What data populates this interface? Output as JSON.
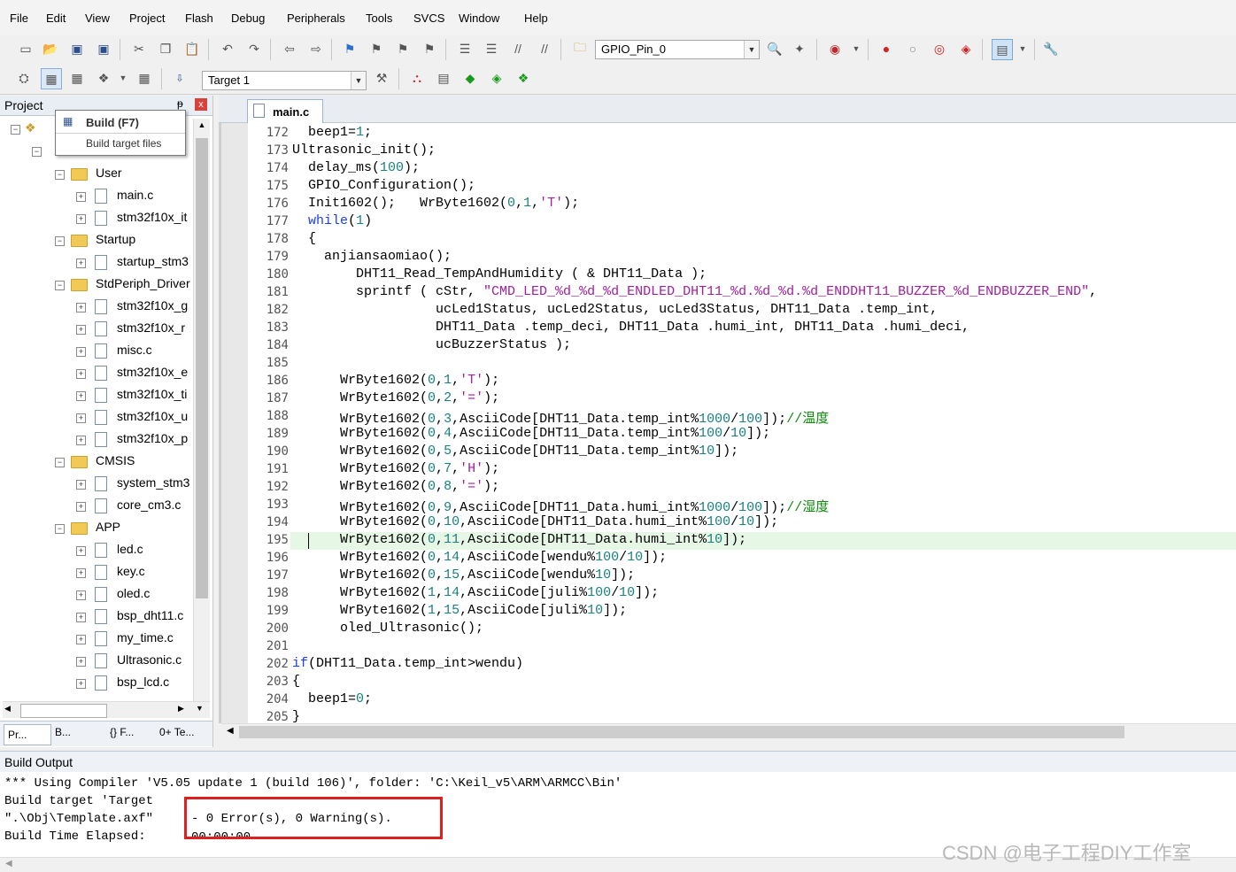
{
  "menu": [
    "File",
    "Edit",
    "View",
    "Project",
    "Flash",
    "Debug",
    "Peripherals",
    "Tools",
    "SVCS",
    "Window",
    "Help"
  ],
  "toolbar1": {
    "target_combo": "GPIO_Pin_0"
  },
  "toolbar2": {
    "target_combo": "Target 1"
  },
  "project_panel": {
    "title": "Project",
    "pin": "ᵽ",
    "close": "x",
    "tooltip": {
      "title": "Build (F7)",
      "desc": "Build target files"
    },
    "tree": [
      {
        "label": "User",
        "type": "folder",
        "indent": 1
      },
      {
        "label": "main.c",
        "type": "file",
        "indent": 2
      },
      {
        "label": "stm32f10x_it",
        "type": "file",
        "indent": 2
      },
      {
        "label": "Startup",
        "type": "folder",
        "indent": 1
      },
      {
        "label": "startup_stm3",
        "type": "file",
        "indent": 2
      },
      {
        "label": "StdPeriph_Driver",
        "type": "folder",
        "indent": 1
      },
      {
        "label": "stm32f10x_g",
        "type": "file",
        "indent": 2
      },
      {
        "label": "stm32f10x_r",
        "type": "file",
        "indent": 2
      },
      {
        "label": "misc.c",
        "type": "file",
        "indent": 2
      },
      {
        "label": "stm32f10x_e",
        "type": "file",
        "indent": 2
      },
      {
        "label": "stm32f10x_ti",
        "type": "file",
        "indent": 2
      },
      {
        "label": "stm32f10x_u",
        "type": "file",
        "indent": 2
      },
      {
        "label": "stm32f10x_p",
        "type": "file",
        "indent": 2
      },
      {
        "label": "CMSIS",
        "type": "folder",
        "indent": 1
      },
      {
        "label": "system_stm3",
        "type": "file",
        "indent": 2
      },
      {
        "label": "core_cm3.c",
        "type": "file",
        "indent": 2
      },
      {
        "label": "APP",
        "type": "folder",
        "indent": 1
      },
      {
        "label": "led.c",
        "type": "file",
        "indent": 2
      },
      {
        "label": "key.c",
        "type": "file",
        "indent": 2
      },
      {
        "label": "oled.c",
        "type": "file",
        "indent": 2
      },
      {
        "label": "bsp_dht11.c",
        "type": "file",
        "indent": 2
      },
      {
        "label": "my_time.c",
        "type": "file",
        "indent": 2
      },
      {
        "label": "Ultrasonic.c",
        "type": "file",
        "indent": 2
      },
      {
        "label": "bsp_lcd.c",
        "type": "file",
        "indent": 2
      }
    ],
    "bottom_tabs": [
      "Pr...",
      "B...",
      "{} F...",
      "0+ Te..."
    ]
  },
  "editor": {
    "tab": "main.c",
    "current_line": 195,
    "lines": [
      {
        "n": 172,
        "html": "  beep1=<span class=\"num\">1</span>;"
      },
      {
        "n": 173,
        "html": "Ultrasonic_init();"
      },
      {
        "n": 174,
        "html": "  delay_ms(<span class=\"num\">100</span>);"
      },
      {
        "n": 175,
        "html": "  GPIO_Configuration();"
      },
      {
        "n": 176,
        "html": "  Init1602();   WrByte1602(<span class=\"num\">0</span>,<span class=\"num\">1</span>,<span class=\"str\">'T'</span>);"
      },
      {
        "n": 177,
        "html": "  <span class=\"kw\">while</span>(<span class=\"num\">1</span>)"
      },
      {
        "n": 178,
        "html": "  {"
      },
      {
        "n": 179,
        "html": "    anjiansaomiao();"
      },
      {
        "n": 180,
        "html": "        DHT11_Read_TempAndHumidity ( & DHT11_Data );"
      },
      {
        "n": 181,
        "html": "        sprintf ( cStr, <span class=\"str\">\"CMD_LED_%d_%d_%d_ENDLED_DHT11_%d.%d_%d.%d_ENDDHT11_BUZZER_%d_ENDBUZZER_END\"</span>,"
      },
      {
        "n": 182,
        "html": "                  ucLed1Status, ucLed2Status, ucLed3Status, DHT11_Data .temp_int,"
      },
      {
        "n": 183,
        "html": "                  DHT11_Data .temp_deci, DHT11_Data .humi_int, DHT11_Data .humi_deci,"
      },
      {
        "n": 184,
        "html": "                  ucBuzzerStatus );"
      },
      {
        "n": 185,
        "html": ""
      },
      {
        "n": 186,
        "html": "      WrByte1602(<span class=\"num\">0</span>,<span class=\"num\">1</span>,<span class=\"str\">'T'</span>);"
      },
      {
        "n": 187,
        "html": "      WrByte1602(<span class=\"num\">0</span>,<span class=\"num\">2</span>,<span class=\"str\">'='</span>);"
      },
      {
        "n": 188,
        "html": "      WrByte1602(<span class=\"num\">0</span>,<span class=\"num\">3</span>,AsciiCode[DHT11_Data.temp_int%<span class=\"num\">1000</span>/<span class=\"num\">100</span>]);<span class=\"cm\">//温度</span>"
      },
      {
        "n": 189,
        "html": "      WrByte1602(<span class=\"num\">0</span>,<span class=\"num\">4</span>,AsciiCode[DHT11_Data.temp_int%<span class=\"num\">100</span>/<span class=\"num\">10</span>]);"
      },
      {
        "n": 190,
        "html": "      WrByte1602(<span class=\"num\">0</span>,<span class=\"num\">5</span>,AsciiCode[DHT11_Data.temp_int%<span class=\"num\">10</span>]);"
      },
      {
        "n": 191,
        "html": "      WrByte1602(<span class=\"num\">0</span>,<span class=\"num\">7</span>,<span class=\"str\">'H'</span>);"
      },
      {
        "n": 192,
        "html": "      WrByte1602(<span class=\"num\">0</span>,<span class=\"num\">8</span>,<span class=\"str\">'='</span>);"
      },
      {
        "n": 193,
        "html": "      WrByte1602(<span class=\"num\">0</span>,<span class=\"num\">9</span>,AsciiCode[DHT11_Data.humi_int%<span class=\"num\">1000</span>/<span class=\"num\">100</span>]);<span class=\"cm\">//湿度</span>"
      },
      {
        "n": 194,
        "html": "      WrByte1602(<span class=\"num\">0</span>,<span class=\"num\">10</span>,AsciiCode[DHT11_Data.humi_int%<span class=\"num\">100</span>/<span class=\"num\">10</span>]);"
      },
      {
        "n": 195,
        "html": "      WrByte1602(<span class=\"num\">0</span>,<span class=\"num\">11</span>,AsciiCode[DHT11_Data.humi_int%<span class=\"num\">10</span>]);"
      },
      {
        "n": 196,
        "html": "      WrByte1602(<span class=\"num\">0</span>,<span class=\"num\">14</span>,AsciiCode[wendu%<span class=\"num\">100</span>/<span class=\"num\">10</span>]);"
      },
      {
        "n": 197,
        "html": "      WrByte1602(<span class=\"num\">0</span>,<span class=\"num\">15</span>,AsciiCode[wendu%<span class=\"num\">10</span>]);"
      },
      {
        "n": 198,
        "html": "      WrByte1602(<span class=\"num\">1</span>,<span class=\"num\">14</span>,AsciiCode[juli%<span class=\"num\">100</span>/<span class=\"num\">10</span>]);"
      },
      {
        "n": 199,
        "html": "      WrByte1602(<span class=\"num\">1</span>,<span class=\"num\">15</span>,AsciiCode[juli%<span class=\"num\">10</span>]);"
      },
      {
        "n": 200,
        "html": "      oled_Ultrasonic();"
      },
      {
        "n": 201,
        "html": ""
      },
      {
        "n": 202,
        "html": "<span class=\"kw\">if</span>(DHT11_Data.temp_int>wendu)"
      },
      {
        "n": 203,
        "html": "{"
      },
      {
        "n": 204,
        "html": "  beep1=<span class=\"num\">0</span>;"
      },
      {
        "n": 205,
        "html": "}"
      }
    ]
  },
  "build_output": {
    "title": "Build Output",
    "lines": [
      "*** Using Compiler 'V5.05 update 1 (build 106)', folder: 'C:\\Keil_v5\\ARM\\ARMCC\\Bin'",
      "Build target 'Target",
      "\".\\Obj\\Template.axf\"",
      "Build Time Elapsed:"
    ],
    "result": "- 0 Error(s), 0 Warning(s).",
    "result_below": "00:00:00",
    "watermark": "CSDN @电子工程DIY工作室"
  }
}
